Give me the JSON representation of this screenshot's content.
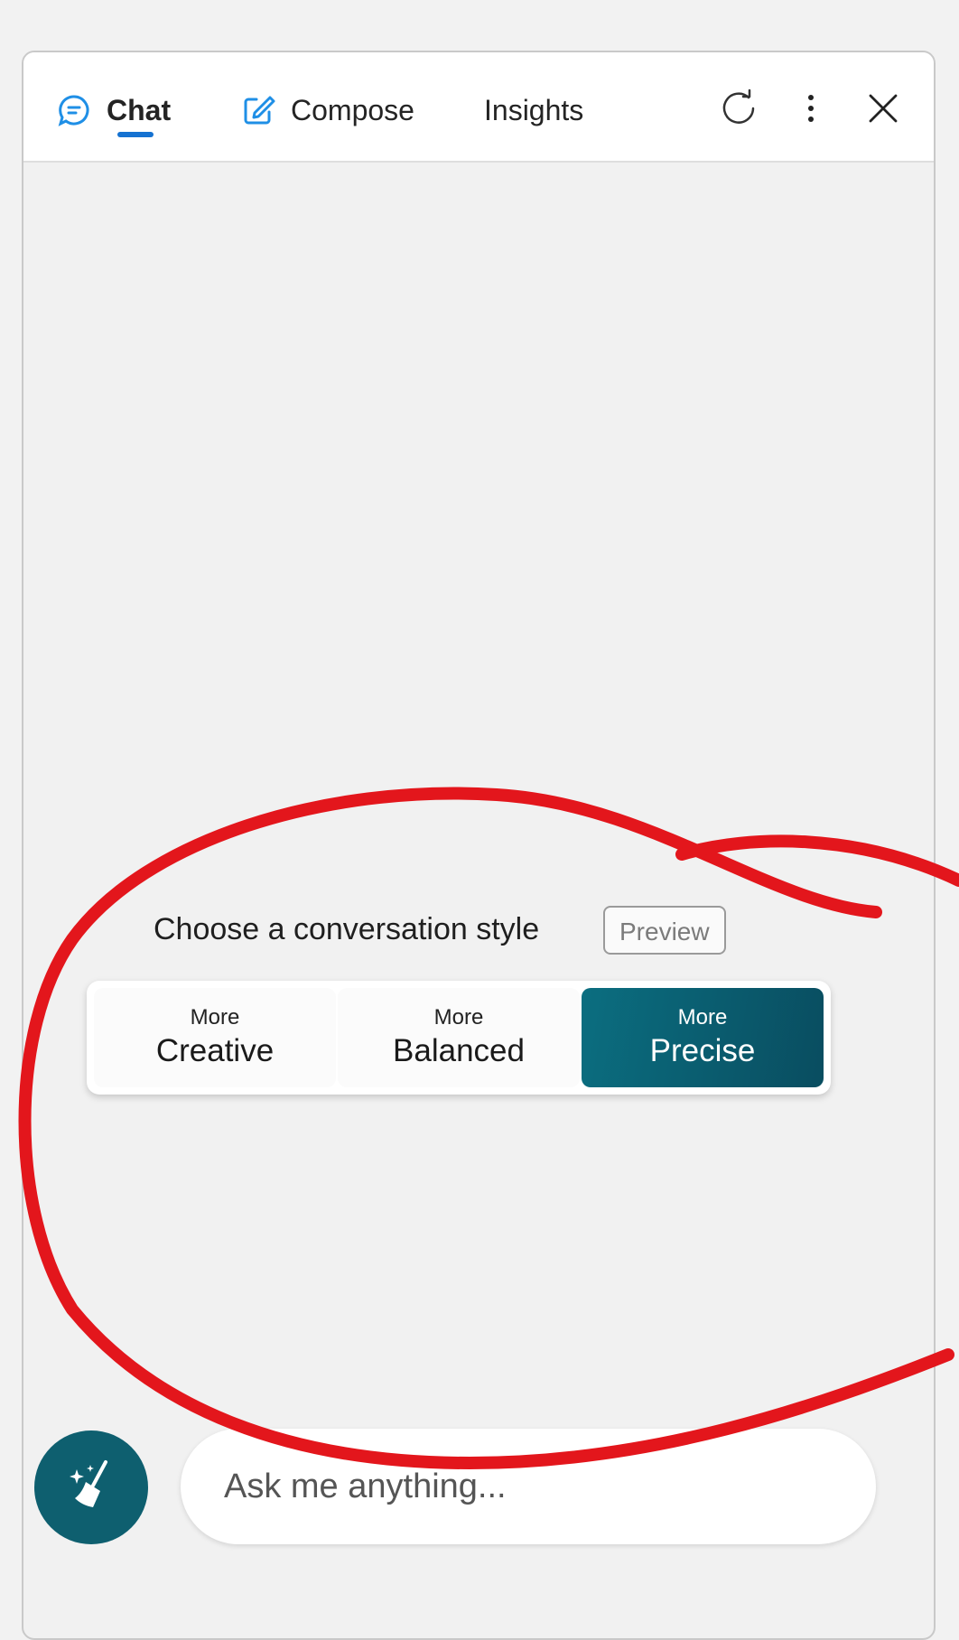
{
  "header": {
    "tabs": [
      {
        "label": "Chat",
        "icon": "chat-bubble-icon",
        "selected": true
      },
      {
        "label": "Compose",
        "icon": "compose-icon",
        "selected": false
      },
      {
        "label": "Insights",
        "selected": false
      }
    ],
    "actions": [
      "refresh-icon",
      "more-vertical-icon",
      "close-icon"
    ]
  },
  "style_picker": {
    "title": "Choose a conversation style",
    "badge": "Preview",
    "options": [
      {
        "prefix": "More",
        "label": "Creative",
        "selected": false
      },
      {
        "prefix": "More",
        "label": "Balanced",
        "selected": false
      },
      {
        "prefix": "More",
        "label": "Precise",
        "selected": true
      }
    ]
  },
  "composer": {
    "placeholder": "Ask me anything...",
    "new_topic_icon": "broom-sparkle-icon"
  },
  "colors": {
    "accent_blue": "#1572d1",
    "precise_teal": "#0b6e80",
    "annotation_red": "#e3161c"
  }
}
